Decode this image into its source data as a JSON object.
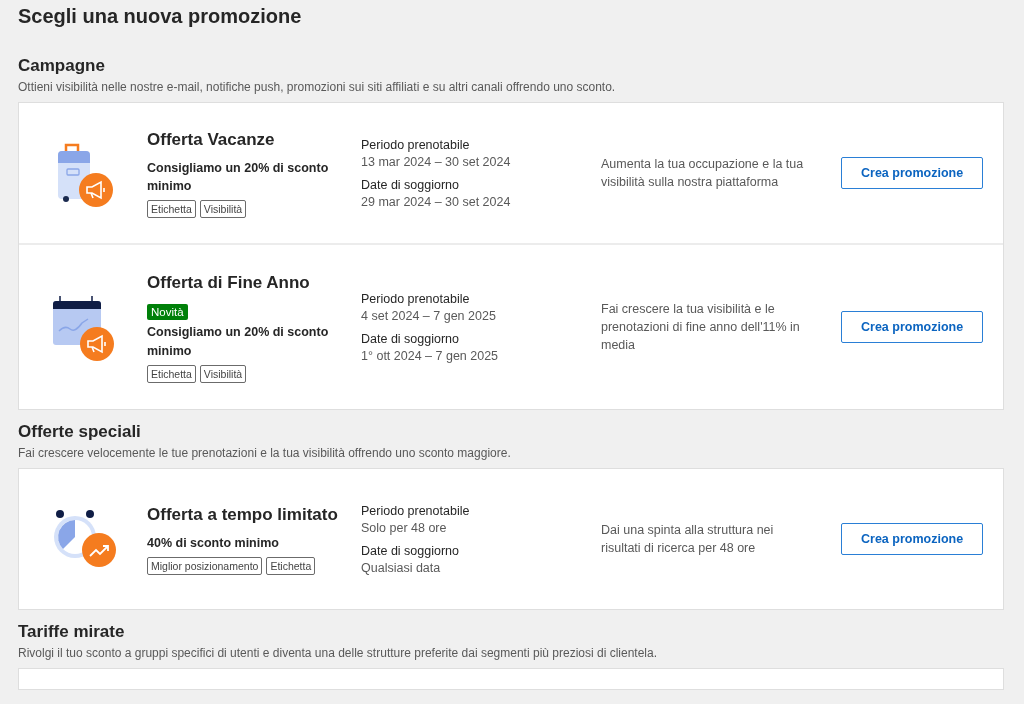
{
  "page_title": "Scegli una nuova promozione",
  "sections": [
    {
      "title": "Campagne",
      "description": "Ottieni visibilità nelle nostre e-mail, notifiche push, promozioni sui siti affiliati e su altri canali offrendo uno sconto.",
      "offers": [
        {
          "kind": "suitcase",
          "title": "Offerta Vacanze",
          "recommendation": "Consigliamo un 20% di sconto minimo",
          "tags": [
            "Etichetta",
            "Visibilità"
          ],
          "dates": [
            {
              "label": "Periodo prenotabile",
              "value": "13 mar 2024 – 30 set 2024"
            },
            {
              "label": "Date di soggiorno",
              "value": "29 mar 2024 – 30 set 2024"
            }
          ],
          "benefit": "Aumenta la tua occupazione e la tua visibilità sulla nostra piattaforma",
          "button": "Crea promozione"
        },
        {
          "kind": "calendar",
          "title": "Offerta di Fine Anno",
          "badge": "Novità",
          "recommendation": "Consigliamo un 20% di sconto minimo",
          "tags": [
            "Etichetta",
            "Visibilità"
          ],
          "dates": [
            {
              "label": "Periodo prenotabile",
              "value": "4 set 2024 – 7 gen 2025"
            },
            {
              "label": "Date di soggiorno",
              "value": "1° ott 2024 – 7 gen 2025"
            }
          ],
          "benefit": "Fai crescere la tua visibilità e le prenotazioni di fine anno dell'11% in media",
          "button": "Crea promozione"
        }
      ]
    },
    {
      "title": "Offerte speciali",
      "description": "Fai crescere velocemente le tue prenotazioni e la tua visibilità offrendo uno sconto maggiore.",
      "offers": [
        {
          "kind": "clock",
          "title": "Offerta a tempo limitato",
          "recommendation": "40% di sconto minimo",
          "tags": [
            "Miglior posizionamento",
            "Etichetta"
          ],
          "dates": [
            {
              "label": "Periodo prenotabile",
              "value": "Solo per 48 ore"
            },
            {
              "label": "Date di soggiorno",
              "value": "Qualsiasi data"
            }
          ],
          "benefit": "Dai una spinta alla struttura nei risultati di ricerca per 48 ore",
          "button": "Crea promozione"
        }
      ]
    },
    {
      "title": "Tariffe mirate",
      "description": "Rivolgi il tuo sconto a gruppi specifici di utenti e diventa una delle strutture preferite dai segmenti più preziosi di clientela."
    }
  ]
}
